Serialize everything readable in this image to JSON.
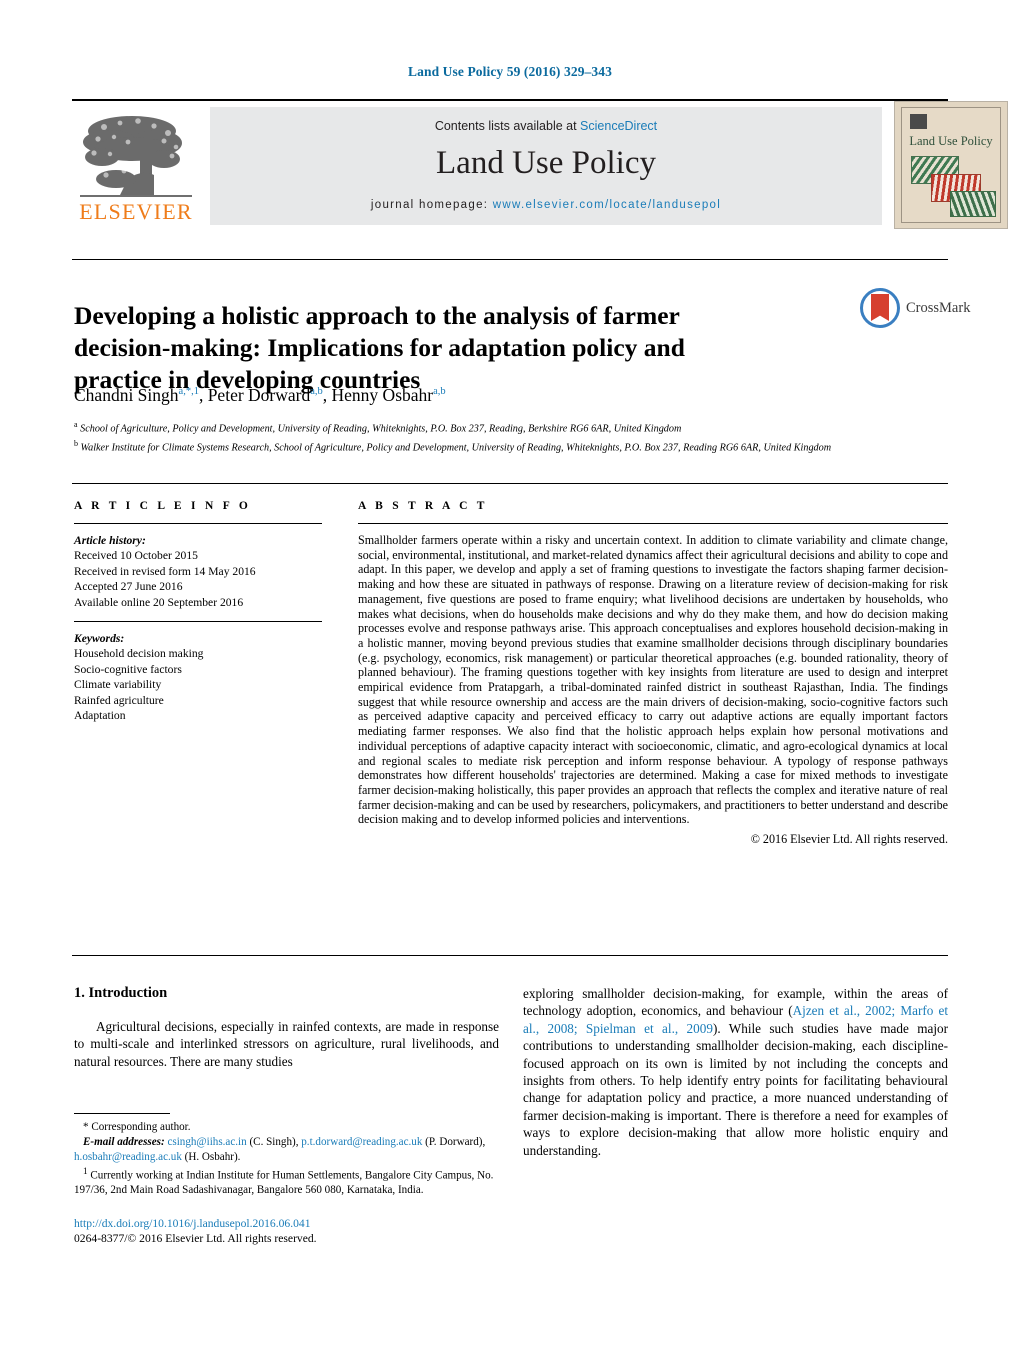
{
  "running_head": "Land Use Policy 59 (2016) 329–343",
  "masthead": {
    "publisher_logo_text": "ELSEVIER",
    "contents_prefix": "Contents lists available at ",
    "contents_link": "ScienceDirect",
    "journal_title": "Land Use Policy",
    "homepage_label": "journal homepage:",
    "homepage_url": "www.elsevier.com/locate/landusepol",
    "cover_title": "Land Use Policy"
  },
  "article": {
    "title": "Developing a holistic approach to the analysis of farmer decision-making: Implications for adaptation policy and practice in developing countries",
    "crossmark_label": "CrossMark",
    "authors": [
      {
        "name": "Chandni Singh",
        "marks": "a,*,1"
      },
      {
        "name": "Peter Dorward",
        "marks": "a,b"
      },
      {
        "name": "Henny Osbahr",
        "marks": "a,b"
      }
    ],
    "affiliations": [
      {
        "mark": "a",
        "text": "School of Agriculture, Policy and Development, University of Reading, Whiteknights, P.O. Box 237, Reading, Berkshire RG6 6AR, United Kingdom"
      },
      {
        "mark": "b",
        "text": "Walker Institute for Climate Systems Research, School of Agriculture, Policy and Development, University of Reading, Whiteknights, P.O. Box 237, Reading RG6 6AR, United Kingdom"
      }
    ]
  },
  "article_info": {
    "heading": "A R T I C L E   I N F O",
    "history_label": "Article history:",
    "history": [
      "Received 10 October 2015",
      "Received in revised form 14 May 2016",
      "Accepted 27 June 2016",
      "Available online 20 September 2016"
    ],
    "keywords_label": "Keywords:",
    "keywords": [
      "Household decision making",
      "Socio-cognitive factors",
      "Climate variability",
      "Rainfed agriculture",
      "Adaptation"
    ]
  },
  "abstract": {
    "heading": "A B S T R A C T",
    "text": "Smallholder farmers operate within a risky and uncertain context. In addition to climate variability and climate change, social, environmental, institutional, and market-related dynamics affect their agricultural decisions and ability to cope and adapt. In this paper, we develop and apply a set of framing questions to investigate the factors shaping farmer decision-making and how these are situated in pathways of response. Drawing on a literature review of decision-making for risk management, five questions are posed to frame enquiry; what livelihood decisions are undertaken by households, who makes what decisions, when do households make decisions and why do they make them, and how do decision making processes evolve and response pathways arise. This approach conceptualises and explores household decision-making in a holistic manner, moving beyond previous studies that examine smallholder decisions through disciplinary boundaries (e.g. psychology, economics, risk management) or particular theoretical approaches (e.g. bounded rationality, theory of planned behaviour). The framing questions together with key insights from literature are used to design and interpret empirical evidence from Pratapgarh, a tribal-dominated rainfed district in southeast Rajasthan, India. The findings suggest that while resource ownership and access are the main drivers of decision-making, socio-cognitive factors such as perceived adaptive capacity and perceived efficacy to carry out adaptive actions are equally important factors mediating farmer responses. We also find that the holistic approach helps explain how personal motivations and individual perceptions of adaptive capacity interact with socioeconomic, climatic, and agro-ecological dynamics at local and regional scales to mediate risk perception and inform response behaviour. A typology of response pathways demonstrates how different households' trajectories are determined. Making a case for mixed methods to investigate farmer decision-making holistically, this paper provides an approach that reflects the complex and iterative nature of real farmer decision-making and can be used by researchers, policymakers, and practitioners to better understand and describe decision making and to develop informed policies and interventions.",
    "copyright": "© 2016 Elsevier Ltd. All rights reserved."
  },
  "body": {
    "section_number_title": "1.  Introduction",
    "left_paragraph": "Agricultural decisions, especially in rainfed contexts, are made in response to multi-scale and interlinked stressors on agriculture, rural livelihoods, and natural resources. There are many studies",
    "right_paragraph_pre": "exploring smallholder decision-making, for example, within the areas of technology adoption, economics, and behaviour (",
    "right_citation": "Ajzen et al., 2002; Marfo et al., 2008; Spielman et al., 2009",
    "right_paragraph_post": "). While such studies have made major contributions to understanding smallholder decision-making, each discipline-focused approach on its own is limited by not including the concepts and insights from others. To help identify entry points for facilitating behavioural change for adaptation policy and practice, a more nuanced understanding of farmer decision-making is important. There is therefore a need for examples of ways to explore decision-making that allow more holistic enquiry and understanding."
  },
  "footnotes": {
    "corresponding": "* Corresponding author.",
    "email_label": "E-mail addresses:",
    "emails": [
      {
        "address": "csingh@iihs.ac.in",
        "owner": "(C. Singh)"
      },
      {
        "address": "p.t.dorward@reading.ac.uk",
        "owner": "(P. Dorward)"
      },
      {
        "address": "h.osbahr@reading.ac.uk",
        "owner": "(H. Osbahr)."
      }
    ],
    "note_mark": "1",
    "note_text": "Currently working at Indian Institute for Human Settlements, Bangalore City Campus, No. 197/36, 2nd Main Road Sadashivanagar, Bangalore 560 080, Karnataka, India."
  },
  "footer": {
    "doi": "http://dx.doi.org/10.1016/j.landusepol.2016.06.041",
    "issn_line": "0264-8377/© 2016 Elsevier Ltd. All rights reserved."
  },
  "colors": {
    "link": "#1a7cb8",
    "running_head": "#0b6a9e",
    "elsevier_orange": "#ef7c1a",
    "band_gray": "#e7e8e9"
  }
}
